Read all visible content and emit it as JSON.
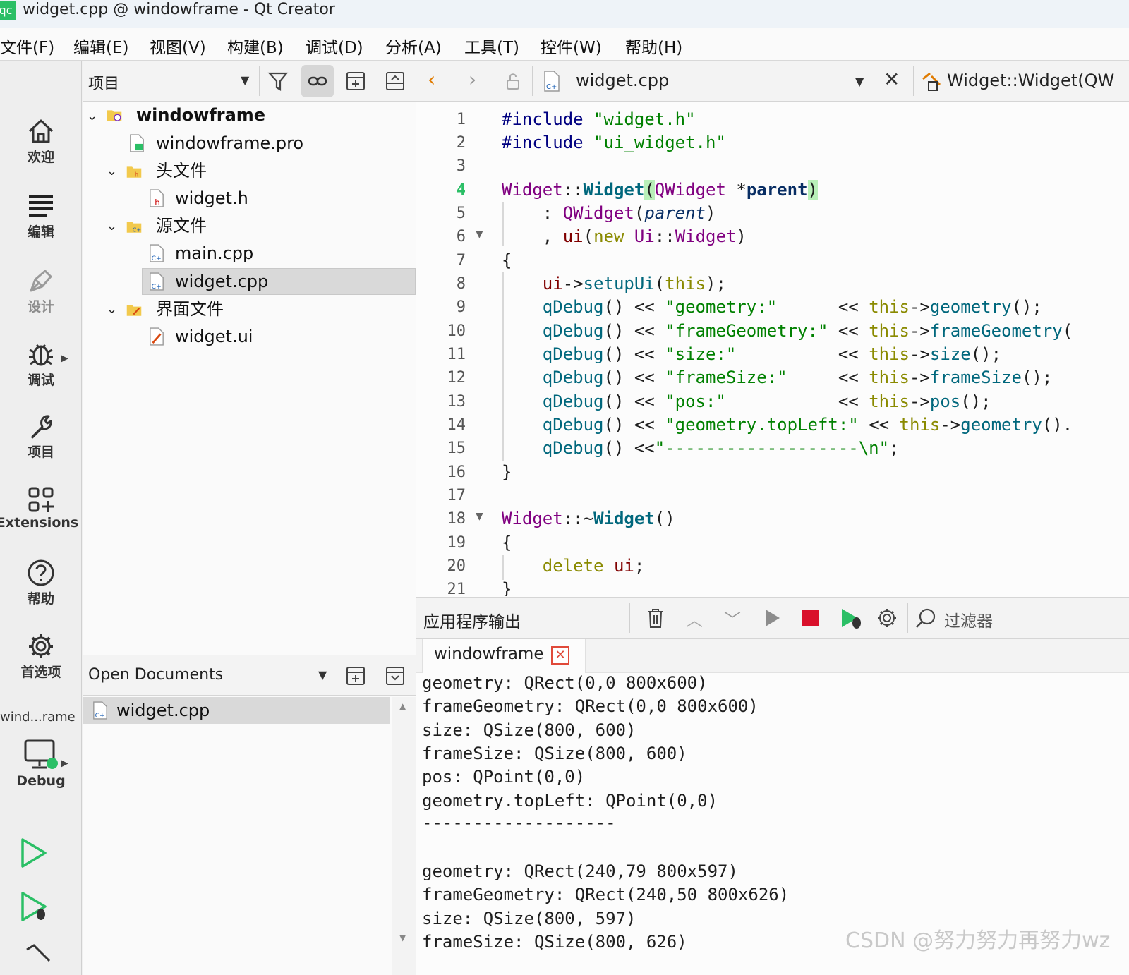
{
  "window": {
    "app_badge": "qc",
    "title": "widget.cpp @ windowframe - Qt Creator"
  },
  "menu": [
    "文件(F)",
    "编辑(E)",
    "视图(V)",
    "构建(B)",
    "调试(D)",
    "分析(A)",
    "工具(T)",
    "控件(W)",
    "帮助(H)"
  ],
  "modes": {
    "welcome": "欢迎",
    "edit": "编辑",
    "design": "设计",
    "debug": "调试",
    "project": "项目",
    "extensions": "Extensions",
    "help": "帮助",
    "preferences": "首选项"
  },
  "kit": {
    "project": "wind...rame",
    "build": "Debug"
  },
  "project_panel": {
    "title": "项目",
    "tree": {
      "root": "windowframe",
      "pro_file": "windowframe.pro",
      "headers_folder": "头文件",
      "header_file": "widget.h",
      "sources_folder": "源文件",
      "source_main": "main.cpp",
      "source_widget": "widget.cpp",
      "forms_folder": "界面文件",
      "form_file": "widget.ui"
    }
  },
  "open_documents": {
    "title": "Open Documents",
    "items": [
      "widget.cpp"
    ]
  },
  "editor": {
    "file": "widget.cpp",
    "symbol": "Widget::Widget(QW",
    "current_line": "4",
    "line_numbers": [
      "1",
      "2",
      "3",
      "4",
      "5",
      "6",
      "7",
      "8",
      "9",
      "10",
      "11",
      "12",
      "13",
      "14",
      "15",
      "16",
      "17",
      "18",
      "19",
      "20",
      "21"
    ]
  },
  "output": {
    "title": "应用程序输出",
    "filter_placeholder": "过滤器",
    "tab": "windowframe",
    "lines": [
      "geometry: QRect(0,0 800x600)",
      "frameGeometry: QRect(0,0 800x600)",
      "size: QSize(800, 600)",
      "frameSize: QSize(800, 600)",
      "pos: QPoint(0,0)",
      "geometry.topLeft: QPoint(0,0)",
      "-------------------",
      "",
      "geometry: QRect(240,79 800x597)",
      "frameGeometry: QRect(240,50 800x626)",
      "size: QSize(800, 597)",
      "frameSize: QSize(800, 626)"
    ]
  },
  "watermark": "CSDN @努力努力再努力wz",
  "colors": {
    "run_green": "#2bbf66",
    "stop_red": "#d9102b",
    "selection": "#d9d9d9",
    "keyword": "#8a8a00",
    "class": "#800080",
    "function": "#00677c",
    "string": "#008000"
  }
}
